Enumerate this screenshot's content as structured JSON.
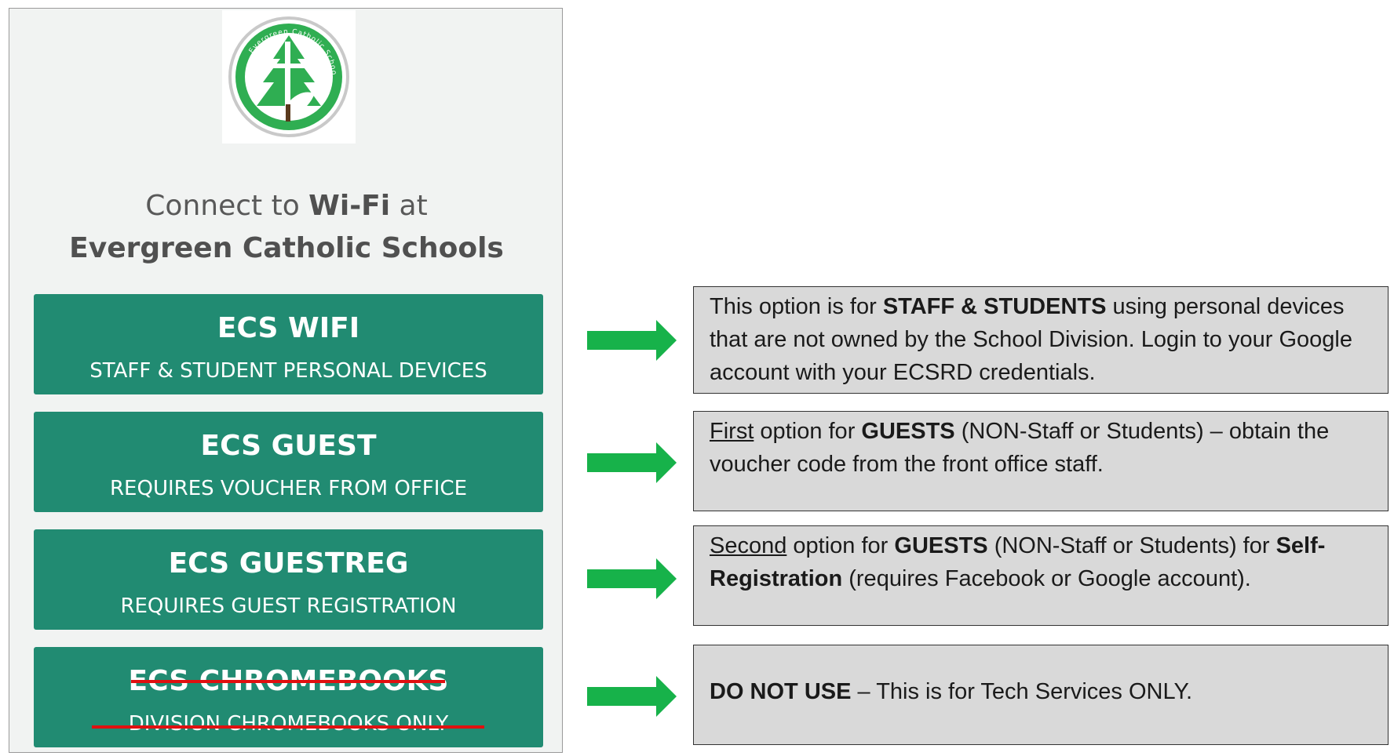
{
  "portal": {
    "logo_text": "Evergreen Catholic Schools",
    "title_line1_pre": "Connect to ",
    "title_line1_bold": "Wi-Fi",
    "title_line1_post": " at",
    "title_line2": "Evergreen Catholic Schools",
    "networks": [
      {
        "name": "ECS WIFI",
        "desc": "STAFF & STUDENT PERSONAL DEVICES"
      },
      {
        "name": "ECS GUEST",
        "desc": "REQUIRES VOUCHER FROM OFFICE"
      },
      {
        "name": "ECS GUESTREG",
        "desc": "REQUIRES GUEST REGISTRATION"
      },
      {
        "name": "ECS CHROMEBOOKS",
        "desc": "DIVISION CHROMEBOOKS ONLY",
        "struck_out": true
      }
    ]
  },
  "notes": [
    {
      "t1": "This option is for ",
      "b1": "STAFF & STUDENTS",
      "t2": " using personal devices that are not owned by the School Division.  Login to your Google account with your ECSRD credentials."
    },
    {
      "u1": "First",
      "t1": " option for ",
      "b1": "GUESTS",
      "t2": " (NON-Staff or Students) – obtain the voucher code from the front office staff."
    },
    {
      "u1": "Second",
      "t1": " option for ",
      "b1": "GUESTS",
      "t2": " (NON-Staff or Students) for ",
      "b2": "Self-Registration",
      "t3": " (requires Facebook or Google account)."
    },
    {
      "b1": "DO NOT USE",
      "t1": " – This is for Tech Services ONLY."
    }
  ],
  "colors": {
    "button": "#218b72",
    "arrow": "#17b24a",
    "strike": "#e01010",
    "note_bg": "#d9d9d9"
  }
}
